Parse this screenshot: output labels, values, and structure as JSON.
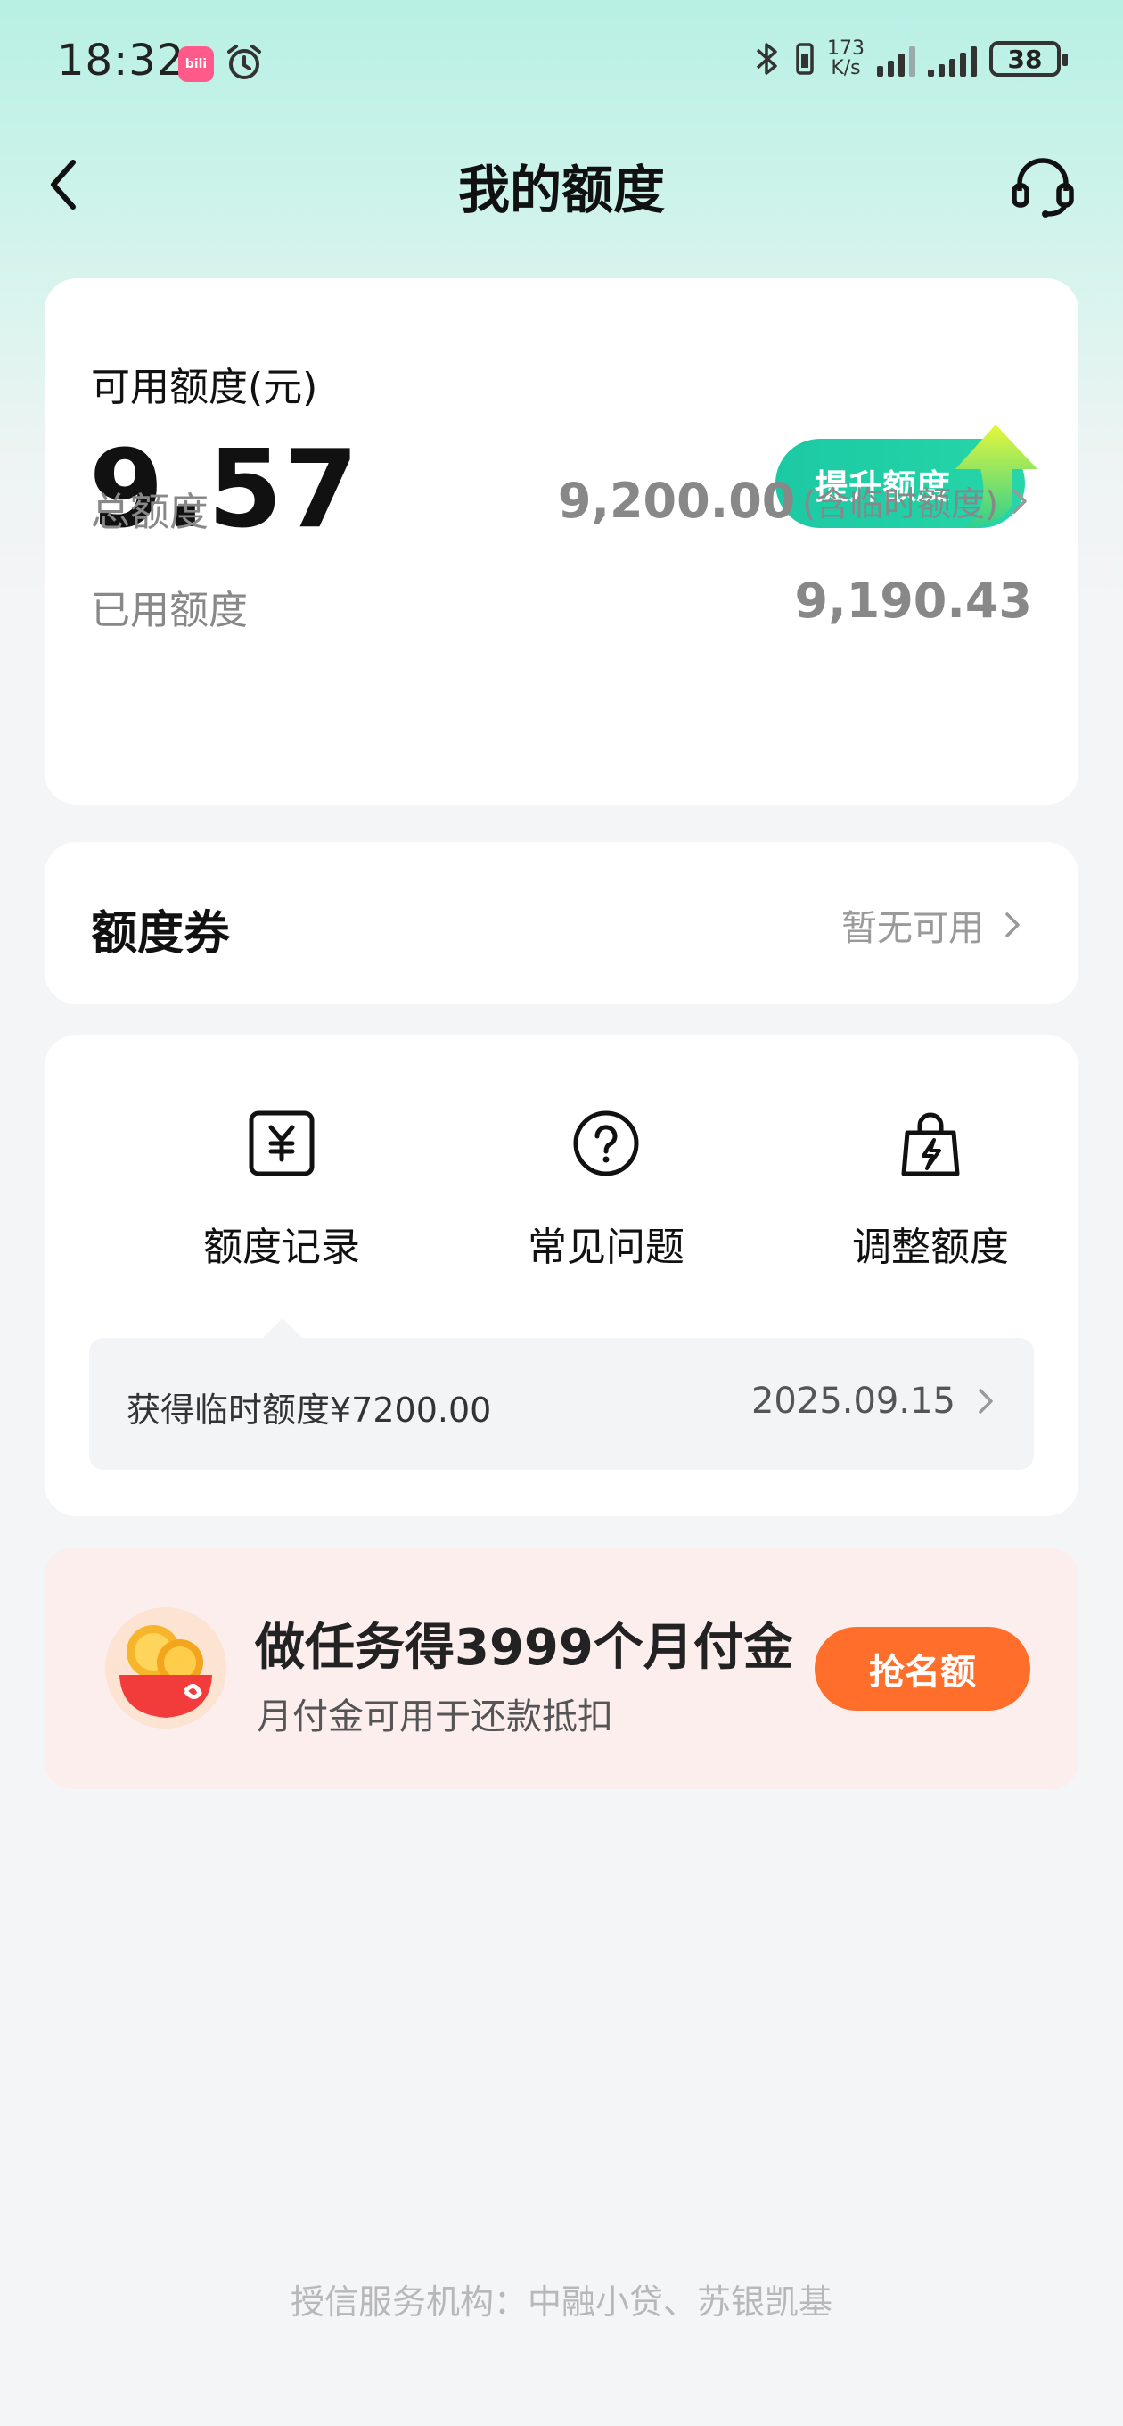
{
  "status_bar": {
    "time": "18:32",
    "app_icon": "bilibili",
    "speed_value": "173",
    "speed_unit": "K/s",
    "battery": "38"
  },
  "header": {
    "title": "我的额度",
    "back_icon": "chevron-left-icon",
    "support_icon": "headset-icon"
  },
  "credit_card": {
    "available_label": "可用额度(元)",
    "available_amount": "9.57",
    "raise_button": "提升额度",
    "total_label": "总额度",
    "total_value": "9,200.00",
    "total_note": "(含临时额度)",
    "used_label": "已用额度",
    "used_value": "9,190.43"
  },
  "coupon_card": {
    "title": "额度券",
    "status": "暂无可用"
  },
  "quick_actions": [
    {
      "label": "额度记录",
      "icon": "yuan-receipt-icon"
    },
    {
      "label": "常见问题",
      "icon": "question-circle-icon"
    },
    {
      "label": "调整额度",
      "icon": "shopping-bag-bolt-icon"
    }
  ],
  "record": {
    "text": "获得临时额度¥7200.00",
    "date": "2025.09.15"
  },
  "promo": {
    "title": "做任务得3999个月付金",
    "subtitle": "月付金可用于还款抵扣",
    "button": "抢名额"
  },
  "footer": {
    "text": "授信服务机构：中融小贷、苏银凯基"
  },
  "colors": {
    "accent_green": "#1cc9a4",
    "promo_orange": "#ff6e2a",
    "header_mint": "#b8f0e4"
  }
}
